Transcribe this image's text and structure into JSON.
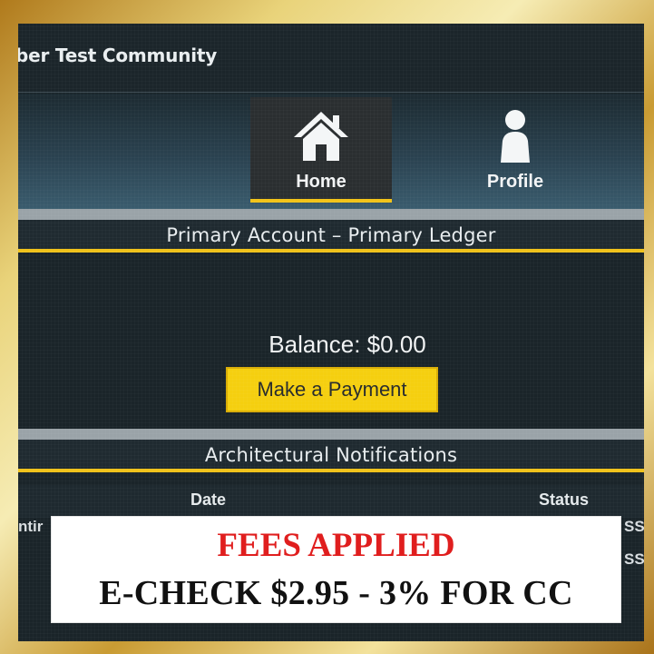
{
  "header": {
    "site_title": "ber Test Community"
  },
  "nav": {
    "items": [
      {
        "label": "Home",
        "icon": "home-icon",
        "active": true
      },
      {
        "label": "Profile",
        "icon": "profile-icon",
        "active": false
      }
    ]
  },
  "account": {
    "section_title": "Primary Account – Primary Ledger",
    "balance_text": "Balance: $0.00",
    "pay_button_label": "Make a Payment"
  },
  "notifications": {
    "section_title": "Architectural Notifications",
    "columns": [
      "Date",
      "Status"
    ],
    "row_fragments": {
      "left": "ntir",
      "right_1": "SS",
      "right_2": "SS"
    }
  },
  "fee_notice": {
    "title": "FEES APPLIED",
    "detail": "E-CHECK $2.95 - 3% FOR CC"
  },
  "colors": {
    "accent": "#f2c318",
    "button": "#f5cf0f",
    "fee_title": "#e01e1e",
    "background": "#1a2429"
  }
}
